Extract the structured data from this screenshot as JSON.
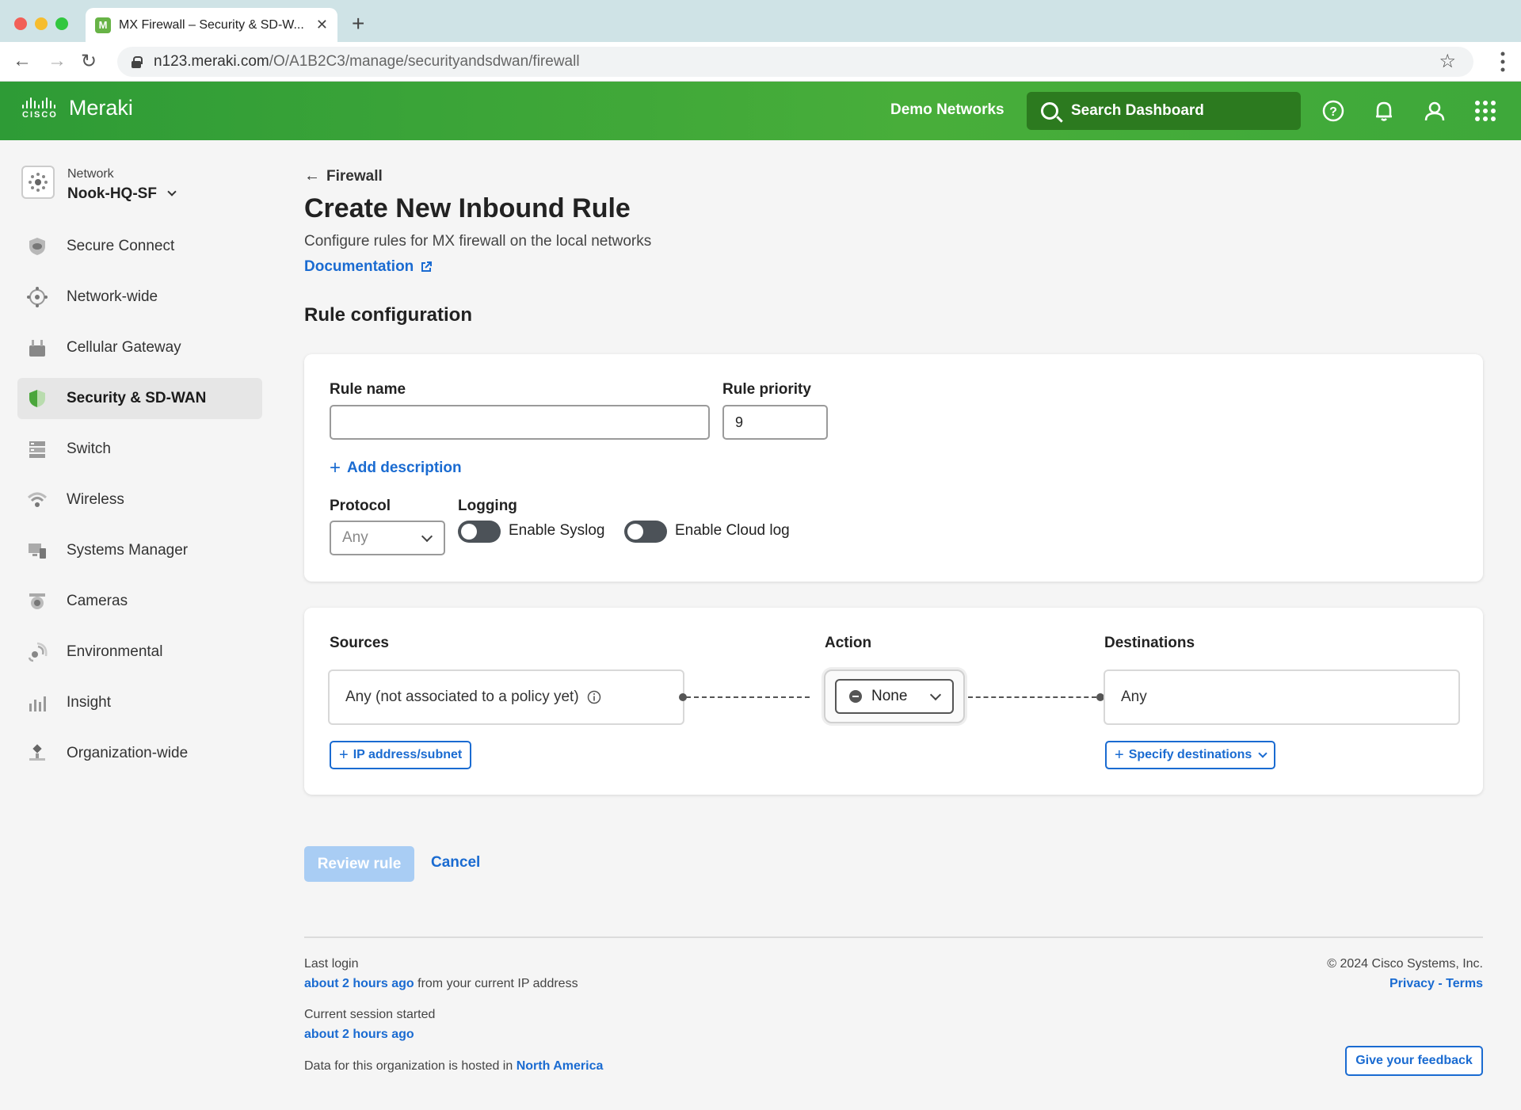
{
  "browser": {
    "tab_title": "MX Firewall – Security & SD-W...",
    "tab_favicon": "M",
    "url_host": "n123.meraki.com",
    "url_path": "/O/A1B2C3/manage/securityandsdwan/firewall"
  },
  "header": {
    "brand_small": "CISCO",
    "brand": "Meraki",
    "demo_networks": "Demo Networks",
    "search_label": "Search Dashboard"
  },
  "sidebar": {
    "network_label": "Network",
    "network_name": "Nook-HQ-SF",
    "items": [
      {
        "label": "Secure Connect",
        "icon": "shield-cloud-icon"
      },
      {
        "label": "Network-wide",
        "icon": "network-icon"
      },
      {
        "label": "Cellular Gateway",
        "icon": "gateway-icon"
      },
      {
        "label": "Security & SD-WAN",
        "icon": "shield-icon"
      },
      {
        "label": "Switch",
        "icon": "switch-icon"
      },
      {
        "label": "Wireless",
        "icon": "wifi-icon"
      },
      {
        "label": "Systems Manager",
        "icon": "devices-icon"
      },
      {
        "label": "Cameras",
        "icon": "camera-icon"
      },
      {
        "label": "Environmental",
        "icon": "sensor-icon"
      },
      {
        "label": "Insight",
        "icon": "chart-icon"
      },
      {
        "label": "Organization-wide",
        "icon": "org-icon"
      }
    ]
  },
  "page": {
    "back_label": "Firewall",
    "title": "Create New Inbound Rule",
    "subtitle": "Configure rules for MX firewall on the local networks",
    "doc_link": "Documentation",
    "section_title": "Rule configuration"
  },
  "rule": {
    "name_label": "Rule name",
    "name_value": "",
    "priority_label": "Rule priority",
    "priority_value": "9",
    "add_description": "Add description",
    "protocol_label": "Protocol",
    "protocol_value": "Any",
    "logging_label": "Logging",
    "syslog_label": "Enable Syslog",
    "cloudlog_label": "Enable Cloud log"
  },
  "flow": {
    "sources_label": "Sources",
    "sources_value": "Any (not associated to a policy yet)",
    "action_label": "Action",
    "action_value": "None",
    "destinations_label": "Destinations",
    "destinations_value": "Any",
    "ip_button": "IP address/subnet",
    "dest_button": "Specify destinations"
  },
  "actions": {
    "review": "Review rule",
    "cancel": "Cancel"
  },
  "footer": {
    "last_login_label": "Last login",
    "last_login_value": "about 2 hours ago",
    "last_login_suffix": " from your current IP address",
    "session_label": "Current session started",
    "session_value": "about 2 hours ago",
    "hosted_prefix": "Data for this organization is hosted in ",
    "hosted_region": "North America",
    "copyright": "© 2024 Cisco Systems, Inc.",
    "privacy": "Privacy",
    "separator": " - ",
    "terms": "Terms",
    "feedback": "Give your feedback"
  },
  "colors": {
    "brand_green": "#3ea83a",
    "link_blue": "#1a6bd1"
  }
}
